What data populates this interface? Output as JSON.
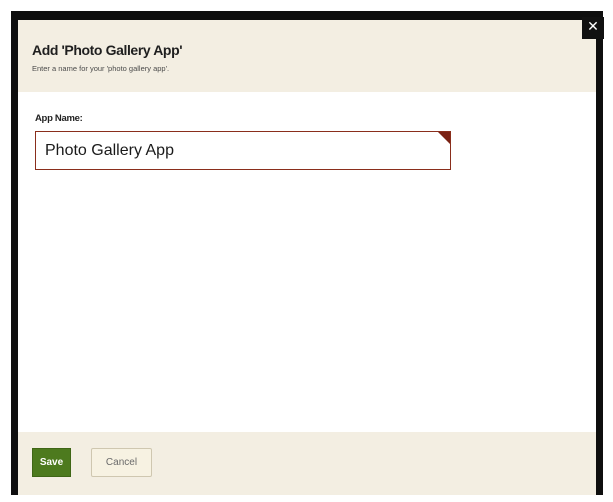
{
  "dialog": {
    "title": "Add 'Photo Gallery App'",
    "subtitle": "Enter a name for your 'photo gallery app'.",
    "close_symbol": "✕",
    "close_icon": "close-icon"
  },
  "form": {
    "app_name_label": "App Name:",
    "app_name_value": "Photo Gallery App",
    "required_indicator": "required-corner-marker"
  },
  "footer": {
    "save_label": "Save",
    "cancel_label": "Cancel"
  },
  "colors": {
    "header_background": "#f3eee2",
    "input_border": "#8a2e1c",
    "save_button": "#4d7a1e",
    "frame_border": "#0e0e0e"
  }
}
